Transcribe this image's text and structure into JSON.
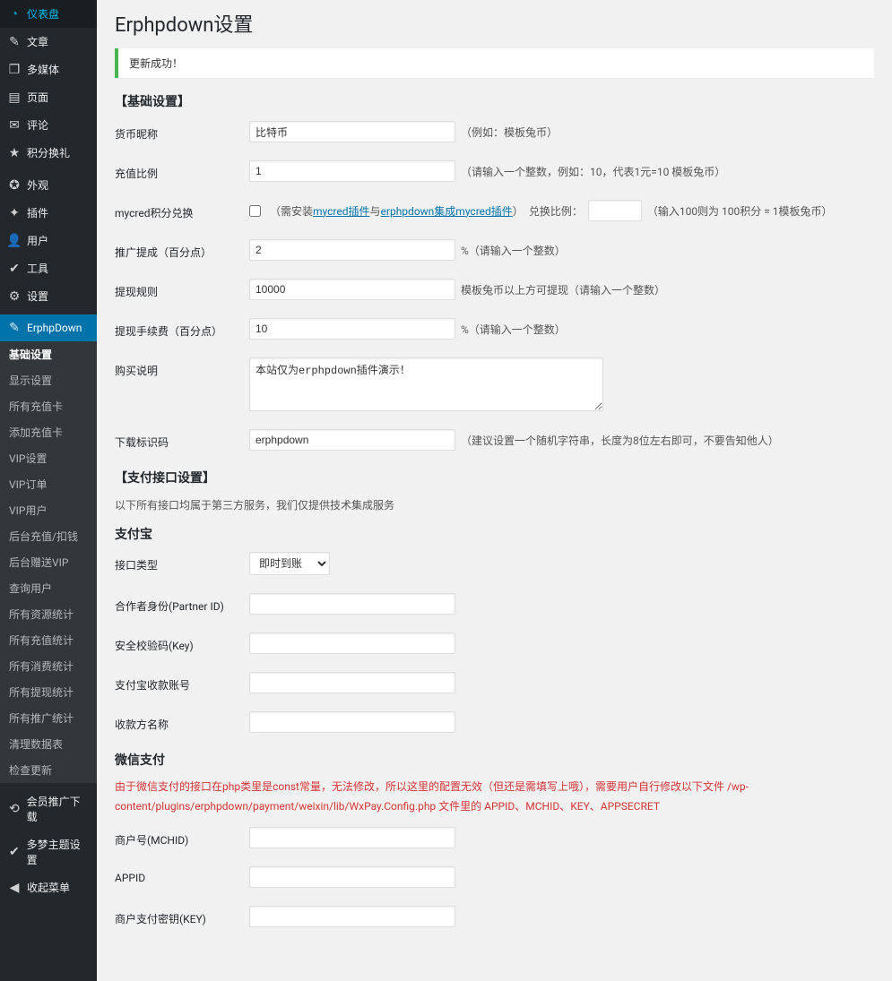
{
  "sidebar": {
    "menu": [
      {
        "icon": "◔",
        "label": "仪表盘",
        "name": "dashboard"
      },
      {
        "icon": "✎",
        "label": "文章",
        "name": "posts"
      },
      {
        "icon": "❐",
        "label": "多媒体",
        "name": "media"
      },
      {
        "icon": "▤",
        "label": "页面",
        "name": "pages"
      },
      {
        "icon": "✉",
        "label": "评论",
        "name": "comments"
      },
      {
        "icon": "★",
        "label": "积分换礼",
        "name": "points-gift"
      },
      {
        "sep": true
      },
      {
        "icon": "✪",
        "label": "外观",
        "name": "appearance"
      },
      {
        "icon": "✦",
        "label": "插件",
        "name": "plugins"
      },
      {
        "icon": "👤",
        "label": "用户",
        "name": "users"
      },
      {
        "icon": "✔",
        "label": "工具",
        "name": "tools"
      },
      {
        "icon": "⚙",
        "label": "设置",
        "name": "settings"
      },
      {
        "sep": true
      },
      {
        "icon": "✎",
        "label": "ErphpDown",
        "name": "erphpdown",
        "current": true
      }
    ],
    "submenu": [
      {
        "label": "基础设置",
        "name": "basic-settings",
        "current": true
      },
      {
        "label": "显示设置",
        "name": "display-settings"
      },
      {
        "label": "所有充值卡",
        "name": "all-cards"
      },
      {
        "label": "添加充值卡",
        "name": "add-card"
      },
      {
        "label": "VIP设置",
        "name": "vip-settings"
      },
      {
        "label": "VIP订单",
        "name": "vip-orders"
      },
      {
        "label": "VIP用户",
        "name": "vip-users"
      },
      {
        "label": "后台充值/扣钱",
        "name": "backend-recharge"
      },
      {
        "label": "后台赠送VIP",
        "name": "backend-gift-vip"
      },
      {
        "label": "查询用户",
        "name": "query-user"
      },
      {
        "label": "所有资源统计",
        "name": "resource-stats"
      },
      {
        "label": "所有充值统计",
        "name": "recharge-stats"
      },
      {
        "label": "所有消费统计",
        "name": "consume-stats"
      },
      {
        "label": "所有提现统计",
        "name": "withdraw-stats"
      },
      {
        "label": "所有推广统计",
        "name": "promo-stats"
      },
      {
        "label": "清理数据表",
        "name": "clean-db"
      },
      {
        "label": "检查更新",
        "name": "check-update"
      }
    ],
    "extra": [
      {
        "icon": "⟲",
        "label": "会员推广下载",
        "name": "member-promo"
      },
      {
        "icon": "✔",
        "label": "多梦主题设置",
        "name": "theme-settings"
      },
      {
        "icon": "◀",
        "label": "收起菜单",
        "name": "collapse-menu"
      }
    ]
  },
  "page": {
    "title": "Erphpdown设置",
    "notice": "更新成功！"
  },
  "basic": {
    "heading": "【基础设置】",
    "currency_label": "货币昵称",
    "currency_value": "比特币",
    "currency_hint": "（例如：模板兔币）",
    "ratio_label": "充值比例",
    "ratio_value": "1",
    "ratio_hint": "（请输入一个整数，例如：10，代表1元=10 模板兔币）",
    "mycred_label": "mycred积分兑换",
    "mycred_prefix": "（需安装",
    "mycred_link1": "mycred插件",
    "mycred_and": "与",
    "mycred_link2": "erphpdown集成mycred插件",
    "mycred_suffix": "）",
    "mycred_ratio_label": "兑换比例：",
    "mycred_ratio_value": "",
    "mycred_ratio_hint": "（输入100则为 100积分 = 1模板兔币）",
    "commission_label": "推广提成（百分点）",
    "commission_value": "2",
    "commission_hint": "%（请输入一个整数）",
    "withdraw_rule_label": "提现规则",
    "withdraw_rule_value": "10000",
    "withdraw_rule_hint": "模板兔币以上方可提现（请输入一个整数）",
    "withdraw_fee_label": "提现手续费（百分点）",
    "withdraw_fee_value": "10",
    "withdraw_fee_hint": "%（请输入一个整数）",
    "buy_note_label": "购买说明",
    "buy_note_value": "本站仅为erphpdown插件演示！",
    "download_code_label": "下载标识码",
    "download_code_value": "erphpdown",
    "download_code_hint": "（建议设置一个随机字符串，长度为8位左右即可，不要告知他人）"
  },
  "pay": {
    "heading": "【支付接口设置】",
    "note": "以下所有接口均属于第三方服务，我们仅提供技术集成服务",
    "alipay_heading": "支付宝",
    "api_type_label": "接口类型",
    "api_type_value": "即时到账",
    "partner_label": "合作者身份(Partner ID)",
    "partner_value": "",
    "key_label": "安全校验码(Key)",
    "key_value": "",
    "account_label": "支付宝收款账号",
    "account_value": "",
    "payee_label": "收款方名称",
    "payee_value": "",
    "wechat_heading": "微信支付",
    "wechat_warn": "由于微信支付的接口在php类里是const常量，无法修改，所以这里的配置无效（但还是需填写上哦），需要用户自行修改以下文件 /wp-content/plugins/erphpdown/payment/weixin/lib/WxPay.Config.php 文件里的 APPID、MCHID、KEY、APPSECRET",
    "mchid_label": "商户号(MCHID)",
    "mchid_value": "",
    "appid_label": "APPID",
    "appid_value": "",
    "wxkey_label": "商户支付密钥(KEY)",
    "wxkey_value": ""
  }
}
